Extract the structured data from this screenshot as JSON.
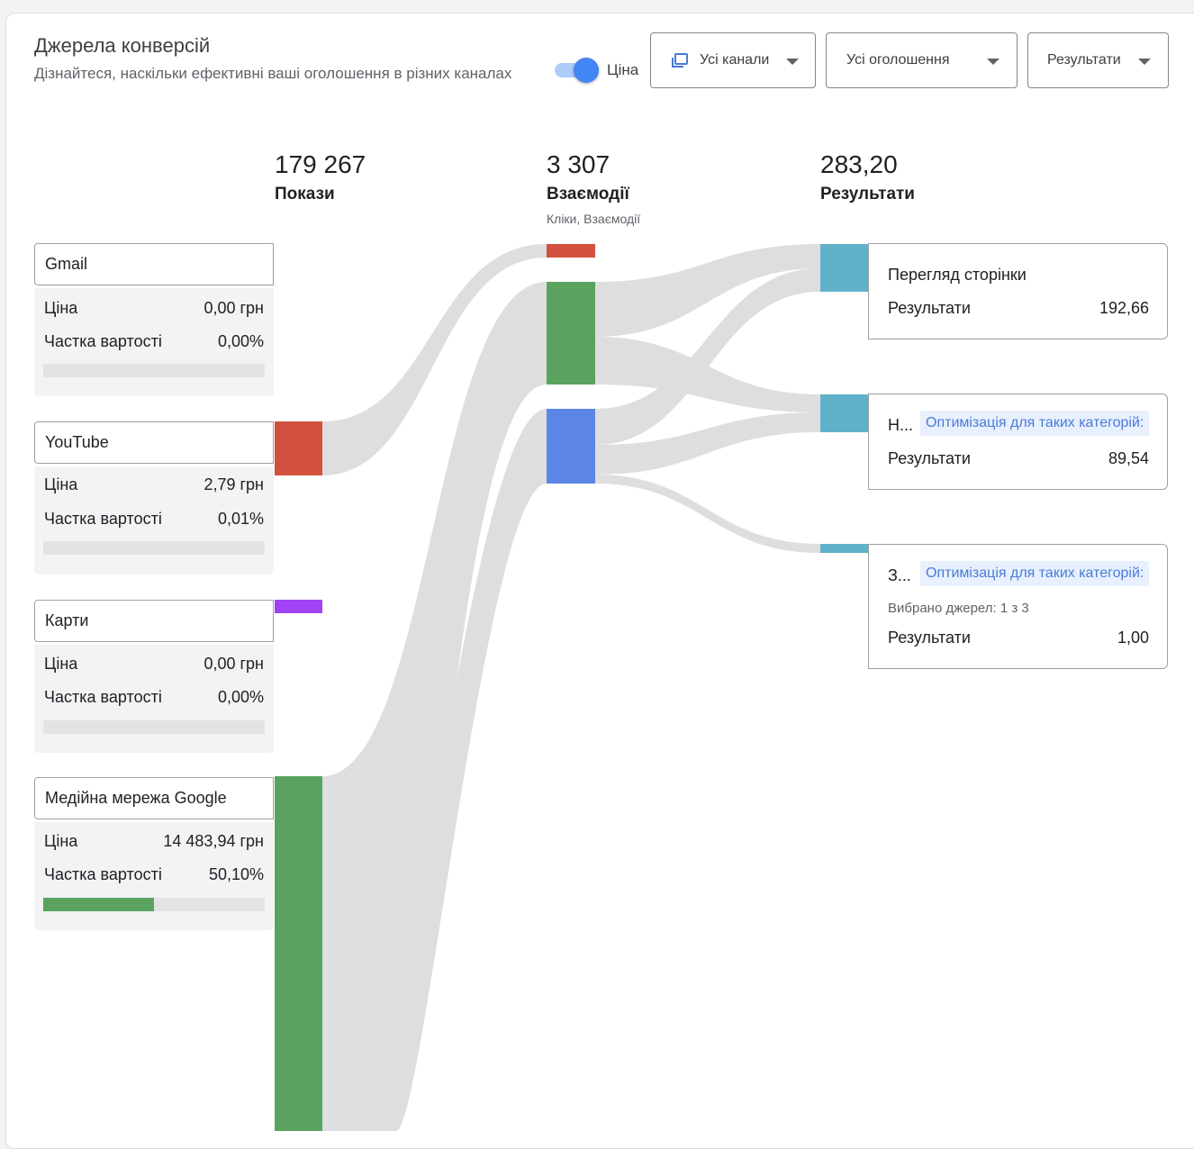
{
  "header": {
    "title": "Джерела конверсій",
    "subtitle": "Дізнайтеся, наскільки ефективні ваші оголошення в різних каналах",
    "toggle_label": "Ціна",
    "toggle_on": true,
    "filters": [
      {
        "label": "Усі канали",
        "icon": "channels-icon"
      },
      {
        "label": "Усі оголошення"
      },
      {
        "label": "Результати"
      }
    ]
  },
  "columns": [
    {
      "value": "179 267",
      "label": "Покази",
      "sub": ""
    },
    {
      "value": "3 307",
      "label": "Взаємодії",
      "sub": "Кліки, Взаємодії"
    },
    {
      "value": "283,20",
      "label": "Результати",
      "sub": ""
    }
  ],
  "sources": [
    {
      "name": "Gmail",
      "cost_label": "Ціна",
      "cost": "0,00 грн",
      "share_label": "Частка вартості",
      "share": "0,00%",
      "share_value": 0.0,
      "color": "#5aa35e"
    },
    {
      "name": "YouTube",
      "cost_label": "Ціна",
      "cost": "2,79 грн",
      "share_label": "Частка вартості",
      "share": "0,01%",
      "share_value": 0.0001,
      "color": "#d2513e"
    },
    {
      "name": "Карти",
      "cost_label": "Ціна",
      "cost": "0,00 грн",
      "share_label": "Частка вартості",
      "share": "0,00%",
      "share_value": 0.0,
      "color": "#a142f4"
    },
    {
      "name": "Медійна мережа Google",
      "cost_label": "Ціна",
      "cost": "14 483,94 грн",
      "share_label": "Частка вартості",
      "share": "50,10%",
      "share_value": 0.501,
      "color": "#5aa35e"
    }
  ],
  "interactions": [
    {
      "color": "#d2513e"
    },
    {
      "color": "#5aa35e"
    },
    {
      "color": "#5b86e5"
    }
  ],
  "results": [
    {
      "title": "Перегляд сторінки",
      "chip": "",
      "selected": "",
      "label": "Результати",
      "value": "192,66"
    },
    {
      "title": "Н...",
      "chip": "Оптимізація для таких категорій:",
      "selected": "",
      "label": "Результати",
      "value": "89,54"
    },
    {
      "title": "З...",
      "chip": "Оптимізація для таких категорій:",
      "selected": "Вибрано джерел: 1 з 3",
      "label": "Результати",
      "value": "1,00"
    }
  ],
  "colors": {
    "result_node": "#61b1c9",
    "flow": "#d3d4d5",
    "accent": "#4285f4"
  }
}
